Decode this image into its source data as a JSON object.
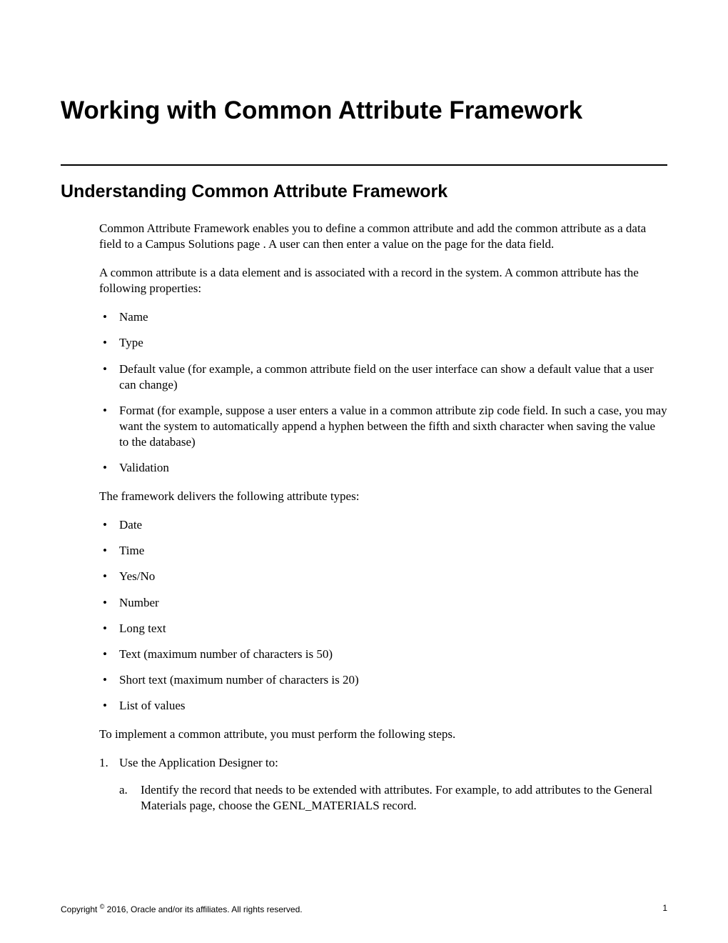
{
  "chapter_title": "Working with Common Attribute Framework",
  "section_title": "Understanding Common Attribute Framework",
  "intro_paragraph": "Common Attribute Framework enables you to define a common attribute and add the common attribute as a data field to a Campus Solutions page . A user can then enter a value on the page for the data field.",
  "definition_paragraph": "A common attribute is a data element and is associated with a record in the system. A common attribute has the following properties:",
  "properties_list": [
    "Name",
    "Type",
    "Default value (for example, a common attribute field on the user interface can show a default value that a user can change)",
    "Format (for example, suppose a user enters a value in a common attribute zip code field. In such a case, you may want the system to automatically append a hyphen between the fifth and sixth character when saving the value to the database)",
    "Validation"
  ],
  "types_intro": "The framework delivers the following attribute types:",
  "types_list": [
    "Date",
    "Time",
    "Yes/No",
    "Number",
    "Long text",
    "Text (maximum number of characters is 50)",
    "Short text (maximum number of characters is 20)",
    "List of values"
  ],
  "implement_intro": "To implement a common attribute, you must perform the following steps.",
  "step1_marker": "1.",
  "step1_text": "Use the Application Designer to:",
  "step1a_marker": "a.",
  "step1a_text": "Identify the record that needs to be extended with attributes. For example, to add attributes to the General Materials page, choose the GENL_MATERIALS record.",
  "footer": {
    "copyright_prefix": "Copyright ",
    "copyright_symbol": "©",
    "copyright_text": " 2016, Oracle and/or its affiliates. All rights reserved.",
    "page_number": "1"
  }
}
